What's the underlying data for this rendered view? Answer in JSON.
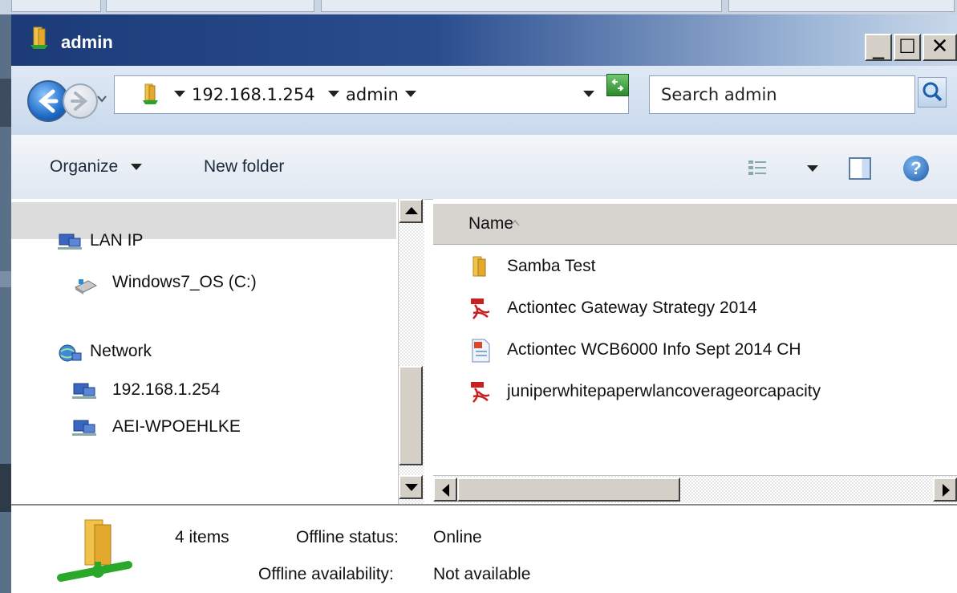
{
  "window": {
    "title": "admin"
  },
  "window_controls": {
    "minimize": "_",
    "maximize": "☐",
    "close": "✕"
  },
  "address": {
    "breadcrumbs": [
      {
        "label": "192.168.1.254"
      },
      {
        "label": "admin"
      }
    ]
  },
  "search": {
    "placeholder": "Search admin"
  },
  "toolbar": {
    "organize": "Organize",
    "new_folder": "New folder",
    "help": "?"
  },
  "nav": {
    "items": [
      {
        "label": "LAN IP",
        "icon": "network-computer-icon"
      },
      {
        "label": "Windows7_OS (C:)",
        "icon": "drive-icon"
      },
      {
        "label": "Network",
        "icon": "network-globe-icon"
      },
      {
        "label": "192.168.1.254",
        "icon": "network-computer-icon",
        "selected": true
      },
      {
        "label": "AEI-WPOEHLKE",
        "icon": "network-computer-icon"
      }
    ]
  },
  "content": {
    "column_header": "Name",
    "files": [
      {
        "name": "Samba Test",
        "type": "folder"
      },
      {
        "name": "Actiontec Gateway Strategy 2014",
        "type": "pdf"
      },
      {
        "name": "Actiontec WCB6000 Info Sept 2014 CH",
        "type": "document"
      },
      {
        "name": "juniperwhitepaperwlancoverageorcapacity",
        "type": "pdf"
      }
    ]
  },
  "status": {
    "item_count": "4 items",
    "offline_status_label": "Offline status:",
    "offline_status_value": "Online",
    "offline_availability_label": "Offline availability:",
    "offline_availability_value": "Not available"
  }
}
